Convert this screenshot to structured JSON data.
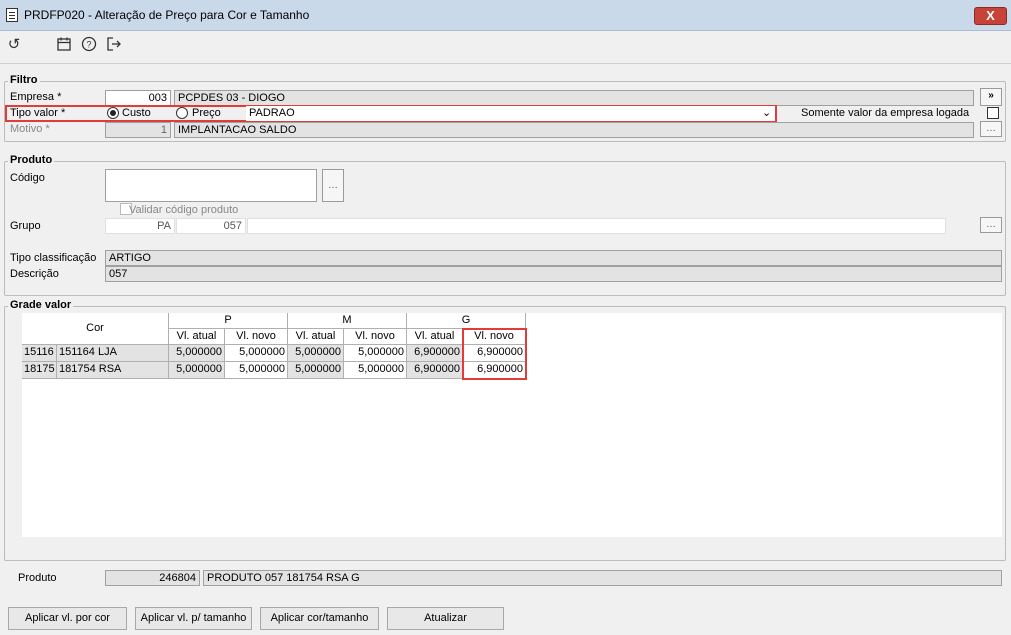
{
  "window": {
    "title": "PRDFP020 - Alteração de Preço para Cor e Tamanho",
    "close_label": "X"
  },
  "toolbar": {
    "icons": [
      "refresh-icon",
      "calendar-icon",
      "help-icon",
      "exit-icon"
    ]
  },
  "filtro": {
    "title": "Filtro",
    "empresa_label": "Empresa *",
    "empresa_code": "003",
    "empresa_name": "PCPDES 03 - DIOGO",
    "empresa_btn": "»",
    "tipo_label": "Tipo valor *",
    "radio_custo": "Custo",
    "radio_preco": "Preço",
    "tipo_select": "PADRAO",
    "somente_label": "Somente valor da empresa logada",
    "motivo_label": "Motivo *",
    "motivo_code": "1",
    "motivo_name": "IMPLANTACAO SALDO"
  },
  "produto": {
    "title": "Produto",
    "codigo_label": "Código",
    "validar_label": "Validar código produto",
    "grupo_label": "Grupo",
    "grupo_code": "PA",
    "grupo_value": "057",
    "tipo_class_label": "Tipo classificação",
    "tipo_class_value": "ARTIGO",
    "descricao_label": "Descrição",
    "descricao_value": "057"
  },
  "grade": {
    "title": "Grade valor",
    "cor_header": "Cor",
    "sizes": [
      "P",
      "M",
      "G"
    ],
    "sub_atual": "Vl. atual",
    "sub_novo": "Vl. novo",
    "rows": [
      {
        "code": "15116",
        "cor": "151164 LJA",
        "p_atual": "5,000000",
        "p_novo": "5,000000",
        "m_atual": "5,000000",
        "m_novo": "5,000000",
        "g_atual": "6,900000",
        "g_novo": "6,900000"
      },
      {
        "code": "18175",
        "cor": "181754 RSA",
        "p_atual": "5,000000",
        "p_novo": "5,000000",
        "m_atual": "5,000000",
        "m_novo": "5,000000",
        "g_atual": "6,900000",
        "g_novo": "6,900000"
      }
    ]
  },
  "footer_produto": {
    "label": "Produto",
    "code": "246804",
    "name": "PRODUTO 057 181754 RSA G"
  },
  "buttons": {
    "aplicar_cor": "Aplicar vl. por cor",
    "aplicar_tamanho": "Aplicar vl. p/ tamanho",
    "aplicar_cor_tamanho": "Aplicar cor/tamanho",
    "atualizar": "Atualizar"
  }
}
